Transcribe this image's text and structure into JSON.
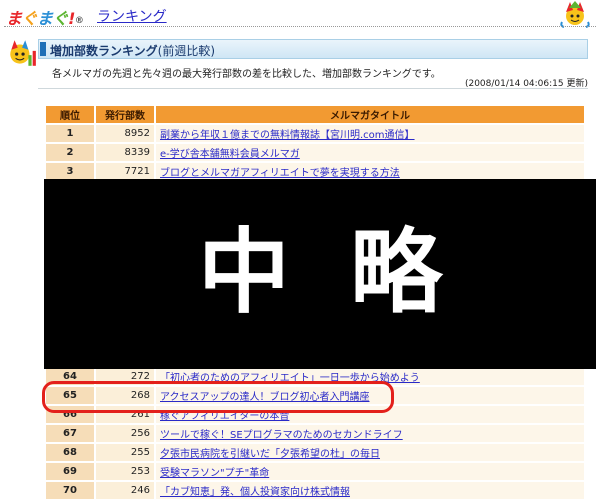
{
  "header": {
    "logo_text": "まぐまぐ!",
    "logo_colors": [
      "#e8262a",
      "#f4a11c",
      "#2b8fd6",
      "#5cb531",
      "#e8262a"
    ],
    "logo_mark": "®",
    "page_link": "ランキング"
  },
  "section": {
    "title": "増加部数ランキング",
    "subtitle": "(前週比較)",
    "description": "各メルマガの先週と先々週の最大発行部数の差を比較した、増加部数ランキングです。",
    "updated": "(2008/01/14 04:06:15 更新)"
  },
  "table": {
    "headers": [
      "順位",
      "発行部数",
      "メルマガタイトル"
    ],
    "top_rows": [
      {
        "rank": "1",
        "count": "8952",
        "title": "副業から年収１億までの無料情報誌【宮川明.com通信】"
      },
      {
        "rank": "2",
        "count": "8339",
        "title": "e-学び舎本舗無料会員メルマガ"
      },
      {
        "rank": "3",
        "count": "7721",
        "title": "ブログとメルマガアフィリエイトで夢を実現する方法"
      }
    ],
    "bottom_rows": [
      {
        "rank": "64",
        "count": "272",
        "title": "「初心者のためのアフィリエイト」一日一歩から始めよう"
      },
      {
        "rank": "65",
        "count": "268",
        "title": "アクセスアップの達人！ブログ初心者入門講座"
      },
      {
        "rank": "66",
        "count": "261",
        "title": "稼ぐアフィリエイターの本音"
      },
      {
        "rank": "67",
        "count": "256",
        "title": "ツールで稼ぐ！SEプログラマのためのセカンドライフ"
      },
      {
        "rank": "68",
        "count": "255",
        "title": "夕張市民病院を引継いだ「夕張希望の杜」の毎日"
      },
      {
        "rank": "69",
        "count": "253",
        "title": "受験マラソン\"プチ\"革命"
      },
      {
        "rank": "70",
        "count": "246",
        "title": "「カブ知恵」発、個人投資家向け株式情報"
      }
    ]
  },
  "omitted_label": "中略",
  "highlighted_rank": "65",
  "colors": {
    "header_orange": "#f29a32",
    "rank_cell": "#f6ddb8",
    "link_blue": "#2a2ac8",
    "highlight_red": "#e3201b"
  }
}
